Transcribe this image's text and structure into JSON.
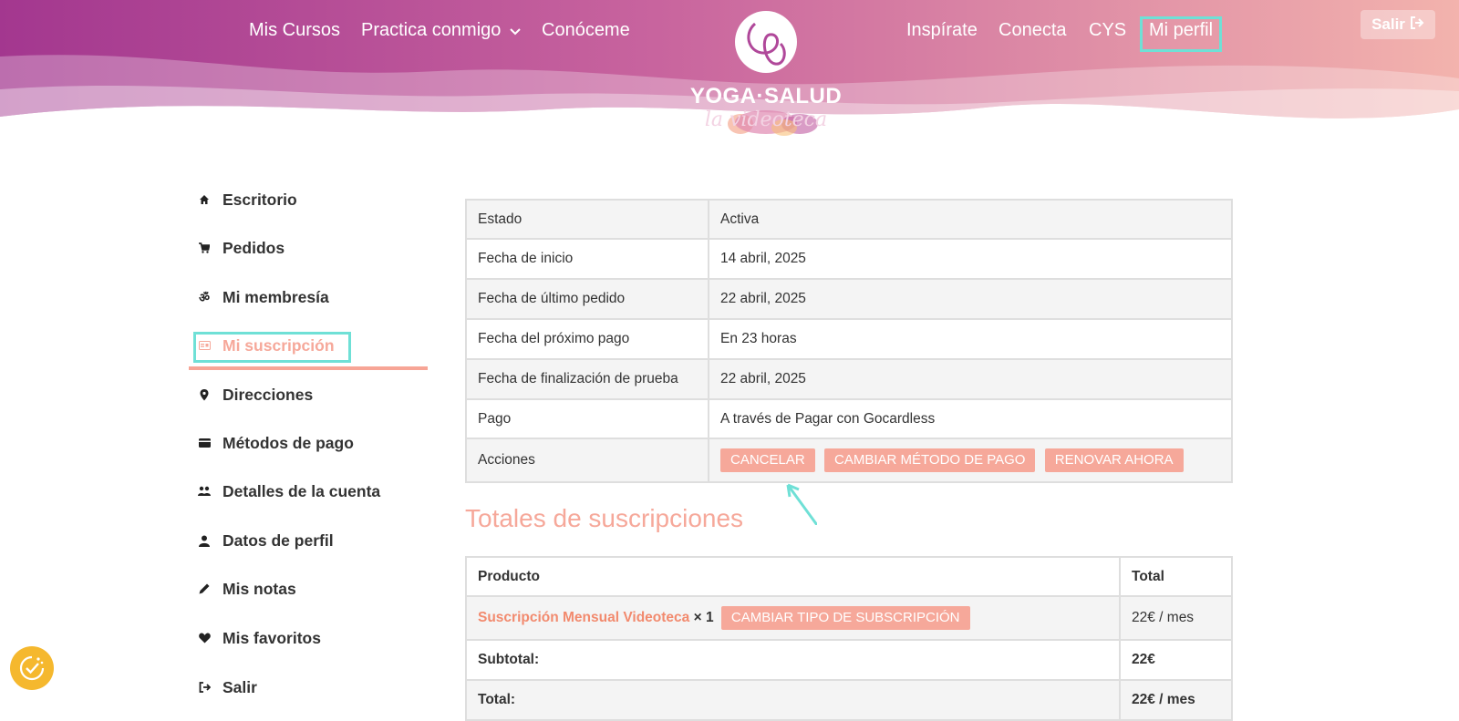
{
  "header": {
    "nav_left": [
      {
        "label": "Mis Cursos"
      },
      {
        "label": "Practica conmigo"
      },
      {
        "label": "Conóceme"
      }
    ],
    "nav_right": [
      {
        "label": "Inspírate"
      },
      {
        "label": "Conecta"
      },
      {
        "label": "CYS"
      },
      {
        "label": "Mi perfil"
      }
    ],
    "logo_title": "YOGA·SALUD",
    "logo_subtitle": "la videoteca",
    "logout_label": "Salir"
  },
  "sidebar": {
    "items": [
      {
        "label": "Escritorio",
        "icon": "home-icon"
      },
      {
        "label": "Pedidos",
        "icon": "cart-icon"
      },
      {
        "label": "Mi membresía",
        "icon": "om-icon"
      },
      {
        "label": "Mi suscripción",
        "icon": "id-card-icon",
        "active": true
      },
      {
        "label": "Direcciones",
        "icon": "map-pin-icon"
      },
      {
        "label": "Métodos de pago",
        "icon": "credit-card-icon"
      },
      {
        "label": "Detalles de la cuenta",
        "icon": "users-icon"
      },
      {
        "label": "Datos de perfil",
        "icon": "user-icon"
      },
      {
        "label": "Mis notas",
        "icon": "pencil-icon"
      },
      {
        "label": "Mis favoritos",
        "icon": "heart-icon"
      },
      {
        "label": "Salir",
        "icon": "sign-out-icon"
      }
    ]
  },
  "subscription": {
    "rows": [
      {
        "label": "Estado",
        "value": "Activa"
      },
      {
        "label": "Fecha de inicio",
        "value": "14 abril, 2025"
      },
      {
        "label": "Fecha de último pedido",
        "value": "22 abril, 2025"
      },
      {
        "label": "Fecha del próximo pago",
        "value": "En 23 horas"
      },
      {
        "label": "Fecha de finalización de prueba",
        "value": "22 abril, 2025"
      },
      {
        "label": "Pago",
        "value": "A través de Pagar con Gocardless"
      }
    ],
    "actions_label": "Acciones",
    "actions": [
      "CANCELAR",
      "CAMBIAR MÉTODO DE PAGO",
      "RENOVAR AHORA"
    ]
  },
  "totals": {
    "title": "Totales de suscripciones",
    "col_product": "Producto",
    "col_total": "Total",
    "product_name": "Suscripción Mensual Videoteca",
    "product_qty": "× 1",
    "change_button": "CAMBIAR TIPO DE SUBSCRIPCIÓN",
    "product_total": "22€ / mes",
    "subtotal_label": "Subtotal:",
    "subtotal_value": "22€",
    "total_label": "Total:",
    "total_value": "22€ / mes"
  },
  "colors": {
    "accent": "#f6a89a",
    "highlight": "#6fe0d6",
    "header_left": "#a3378f",
    "header_right": "#f3b3ad"
  }
}
